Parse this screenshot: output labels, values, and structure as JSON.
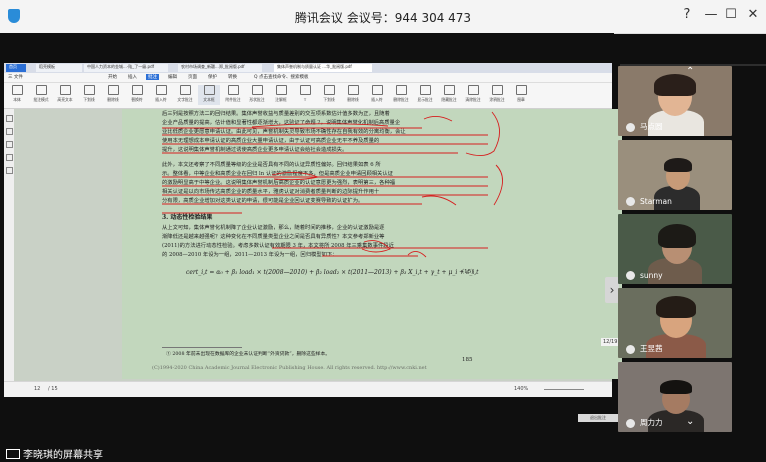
{
  "window": {
    "title": "腾讯会议 会议号：944 304 473",
    "controls": [
      "?",
      "—",
      "☐",
      "✕"
    ]
  },
  "share": {
    "label": "李晓琪的屏幕共享"
  },
  "wps": {
    "tabs": [
      "首页",
      "稻壳模板",
      "中国人力资本的金城...-陆_了一级.pdf",
      "农村市场调查_新疆...郑_批阅版.pdf",
      "集体声誉机制与质量认证 ...华_批阅版.pdf"
    ],
    "menu": [
      "三 文件",
      "开始",
      "插入",
      "批注",
      "编辑",
      "页面",
      "保护",
      "转换",
      "Q 点击查找命令、搜索模板"
    ],
    "menu_active": "批注",
    "tools": [
      "本体",
      "批注模式",
      "高亮文本",
      "下划线",
      "删除线",
      "替换符",
      "插入符",
      "文字批注",
      "文本框",
      "附件批注",
      "形状批注",
      "注解框",
      "T",
      "下划线",
      "删除线",
      "插入符",
      "删除批注",
      "显示批注",
      "隐藏批注",
      "清除批注",
      "涂鸦批注",
      "图章"
    ],
    "status": {
      "page": "12",
      "page_total": "/ 15",
      "zoom": "140%",
      "page_indicator": "12/19",
      "mini_button": "退出批注"
    }
  },
  "document": {
    "lines_top": [
      "后三列是按照方法二的回归结果。集体声誉收益与质量差别的交互项系数估计值多数为正，且随着",
      "企业产品质量的提高，估计值和显著性都逐渐增大，这验证了命题 2，说明集体声誉化机制后高质量企",
      "业比低质企业更愿意申请认证。由此可见，声誉机制失灵导致市场不确性存在自我有效的分离均衡，会让",
      "使用本无理想成本申请认证的高质企业大量申请认证，由于认证可高质企业无平不养及质量的",
      "提升，这说明集体声誉机制通过诱使高质企业更多申请认证会给社会造成损失。"
    ],
    "lines_mid": [
      "此外，本文还考察了不同质量等级的企业是否具有不同的认证异质性偏好。回归结果如表 6 所",
      "示。整体看，中等企业和高质企业在回归 ln 认证的激励程度不多，但是高质企业申请回顾相关认证",
      "的激励明显高于中等企业。这说明集体声誉机制后高质企业的认证意愿更为强烈，表明第三，各种福",
      "相关认证是以向市场传达高质企业的质量水平，雅虎认证对消费者质量判断的边际提升作用十",
      "分有限，高质企业增加对这类认证的申请，很可能是企业回认证变赛导致的认证扩为。"
    ],
    "section_title": "3. 动态性检验结果",
    "lines_bottom": [
      "从上文可知，集体声誉化机制降了企业认证激励，那么，随着时间的推移，企业的认证激励是逐",
      "渐降低还是越来越强呢？这种变化在不同质量类型企业之间是否具有异质性？本文参考郑新业等",
      "(2011)的方法进行动态性检验。考虑多数认证有效期限 3 年，本文将所 2008 年三乘集数事件段近",
      "的 2008—2010 年设为一组，2011—2013 年设为一组，回归模型如下："
    ],
    "formula": "cert_i,t = α₀ + β₁ load₁ × t(2008—2010) + β₂ load₂ × t(2011—2013) + β₃ X_i,t + γ_t + μ_i + ε_i,t",
    "formula_number": "(15)",
    "footnote": "① 2008 年前未出现在数据库的企业未认证判断“外资贷款”，删除这些样本。",
    "page_number": "185",
    "copyright": "(C)1994-2020 China Academic Journal Electronic Publishing House. All rights reserved.    http://www.cnki.net"
  },
  "participants": [
    {
      "name": "马点圆",
      "bg": "#8a7a6a",
      "skin": "#e2b594"
    },
    {
      "name": "Starman",
      "bg": "#9a8f7d",
      "skin": "#c79b78"
    },
    {
      "name": "sunny",
      "bg": "#4a5a48",
      "skin": "#b88f73"
    },
    {
      "name": "王昱茜",
      "bg": "#6a6e5e",
      "skin": "#d8a47e"
    },
    {
      "name": "周力力",
      "bg": "#7d7570",
      "skin": "#a57b62"
    }
  ]
}
